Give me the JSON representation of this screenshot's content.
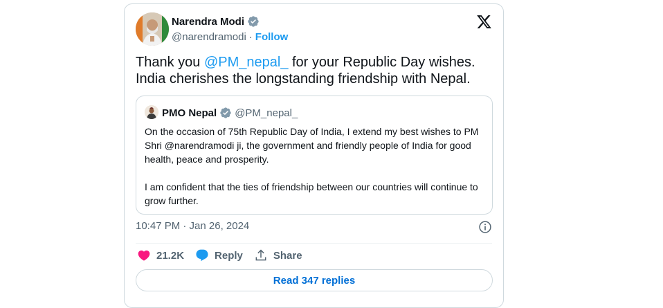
{
  "author": {
    "name": "Narendra Modi",
    "handle": "@narendramodi",
    "separator": "·",
    "follow_label": "Follow"
  },
  "tweet": {
    "text_before": "Thank you ",
    "mention": "@PM_nepal_",
    "text_after": " for your Republic Day wishes. India cherishes the longstanding friendship with Nepal."
  },
  "quoted": {
    "name": "PMO Nepal",
    "handle": "@PM_nepal_",
    "paragraphs": [
      "On the occasion of 75th Republic Day of India, I extend my best wishes to PM Shri @narendramodi ji, the government and friendly people of India for good health, peace and prosperity.",
      "I am confident that the ties of friendship between our countries will continue to grow further."
    ]
  },
  "meta": {
    "timestamp": "10:47 PM · Jan 26, 2024"
  },
  "actions": {
    "likes": "21.2K",
    "reply_label": "Reply",
    "share_label": "Share"
  },
  "read_replies": "Read 347 replies",
  "colors": {
    "accent": "#1d9bf0",
    "like": "#f91880",
    "verified": "#829aab",
    "muted": "#536471"
  },
  "icons": [
    "verified-badge-icon",
    "x-logo-icon",
    "info-icon",
    "heart-icon",
    "reply-bubble-icon",
    "share-icon"
  ]
}
